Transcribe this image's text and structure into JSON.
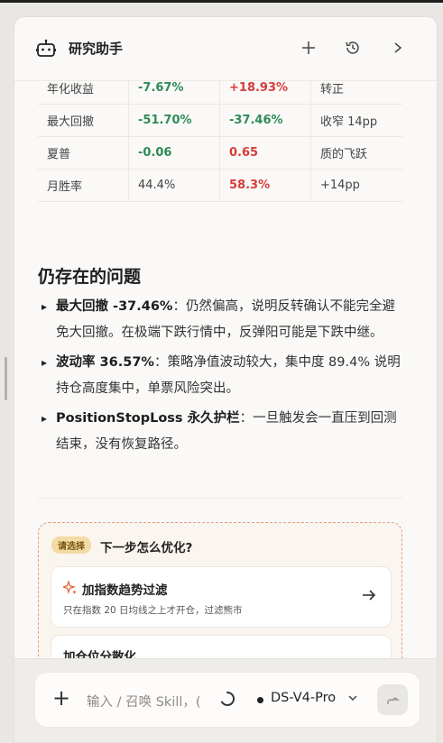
{
  "header": {
    "title": "研究助手"
  },
  "metrics_table": {
    "rows": [
      {
        "label": "年化收益",
        "v1": "-7.67%",
        "v2": "+18.93%",
        "note": "转正"
      },
      {
        "label": "最大回撤",
        "v1": "-51.70%",
        "v2": "-37.46%",
        "note": "收窄 14pp"
      },
      {
        "label": "夏普",
        "v1": "-0.06",
        "v2": "0.65",
        "note": "质的飞跃"
      },
      {
        "label": "月胜率",
        "v1": "44.4%",
        "v2": "58.3%",
        "note": "+14pp"
      }
    ]
  },
  "issues": {
    "title": "仍存在的问题",
    "items": [
      {
        "bold": "最大回撤 -37.46%",
        "text": "：仍然偏高，说明反转确认不能完全避免大回撤。在极端下跌行情中，反弹阳可能是下跌中继。"
      },
      {
        "bold": "波动率 36.57%",
        "text": "：策略净值波动较大，集中度 89.4% 说明持仓高度集中，单票风险突出。"
      },
      {
        "bold": "PositionStopLoss 永久护栏",
        "text": "：一旦触发会一直压到回测结束，没有恢复路径。"
      }
    ]
  },
  "choice": {
    "badge": "请选择",
    "title": "下一步怎么优化?",
    "options": [
      {
        "title": "加指数趋势过滤",
        "desc": "只在指数 20 日均线之上才开仓，过滤熊市",
        "icon": "sparkle-icon"
      },
      {
        "title": "加仓位分散化",
        "desc": ""
      }
    ]
  },
  "composer": {
    "placeholder": "输入 / 召唤 Skill，(",
    "model": "DS-V4-Pro"
  },
  "colors": {
    "positive": "#2e8b57",
    "negative": "#d63c3c",
    "accent_border": "#e0a085"
  }
}
